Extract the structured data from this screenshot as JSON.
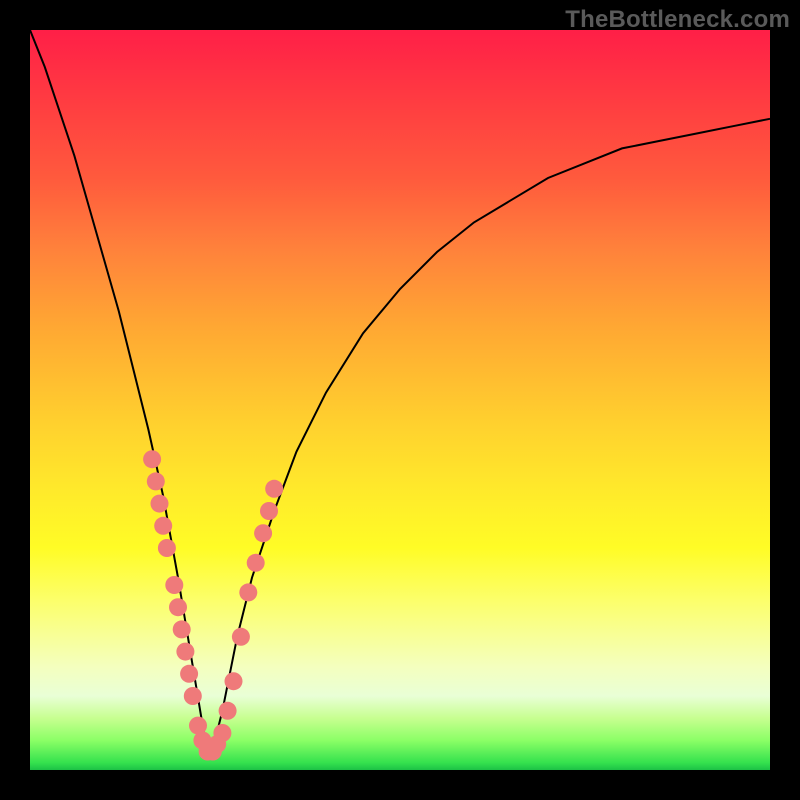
{
  "watermark": "TheBottleneck.com",
  "colors": {
    "frame": "#000000",
    "gradient_top": "#ff1f47",
    "gradient_bottom": "#1cc246",
    "curve": "#000000",
    "marker": "#ef7a7a"
  },
  "chart_data": {
    "type": "line",
    "title": "",
    "xlabel": "",
    "ylabel": "",
    "xlim": [
      0,
      100
    ],
    "ylim": [
      0,
      100
    ],
    "grid": false,
    "legend": false,
    "axes_visible": false,
    "note": "Single V-shaped curve on a vertical rainbow heat gradient. X and Y are normalized 0–100 because the image shows no axis ticks or labels. Y=100 is the top (red), Y=0 is the bottom (green). The curve's minimum reaches ~Y≈2 around X≈24. Salmon-colored marker blobs sit along the lower portion of both arms of the V.",
    "series": [
      {
        "name": "curve",
        "x": [
          0,
          2,
          4,
          6,
          8,
          10,
          12,
          14,
          16,
          18,
          20,
          21,
          22,
          23,
          24,
          25,
          26,
          27,
          28,
          30,
          33,
          36,
          40,
          45,
          50,
          55,
          60,
          65,
          70,
          75,
          80,
          85,
          90,
          95,
          100
        ],
        "y": [
          100,
          95,
          89,
          83,
          76,
          69,
          62,
          54,
          46,
          37,
          26,
          20,
          14,
          8,
          2,
          4,
          8,
          13,
          18,
          26,
          35,
          43,
          51,
          59,
          65,
          70,
          74,
          77,
          80,
          82,
          84,
          85,
          86,
          87,
          88
        ]
      }
    ],
    "markers": {
      "description": "Clusters of rounded salmon markers overlaid on the curve near the trough, on both the descending (left) and ascending (right) arms.",
      "points": [
        {
          "x": 16.5,
          "y": 42
        },
        {
          "x": 17.0,
          "y": 39
        },
        {
          "x": 17.5,
          "y": 36
        },
        {
          "x": 18.0,
          "y": 33
        },
        {
          "x": 18.5,
          "y": 30
        },
        {
          "x": 19.5,
          "y": 25
        },
        {
          "x": 20.0,
          "y": 22
        },
        {
          "x": 20.5,
          "y": 19
        },
        {
          "x": 21.0,
          "y": 16
        },
        {
          "x": 21.5,
          "y": 13
        },
        {
          "x": 22.0,
          "y": 10
        },
        {
          "x": 22.7,
          "y": 6
        },
        {
          "x": 23.3,
          "y": 4
        },
        {
          "x": 24.0,
          "y": 2.5
        },
        {
          "x": 24.7,
          "y": 2.5
        },
        {
          "x": 25.3,
          "y": 3.5
        },
        {
          "x": 26.0,
          "y": 5
        },
        {
          "x": 26.7,
          "y": 8
        },
        {
          "x": 27.5,
          "y": 12
        },
        {
          "x": 28.5,
          "y": 18
        },
        {
          "x": 29.5,
          "y": 24
        },
        {
          "x": 30.5,
          "y": 28
        },
        {
          "x": 31.5,
          "y": 32
        },
        {
          "x": 32.3,
          "y": 35
        },
        {
          "x": 33.0,
          "y": 38
        }
      ],
      "radius_px": 9
    }
  }
}
